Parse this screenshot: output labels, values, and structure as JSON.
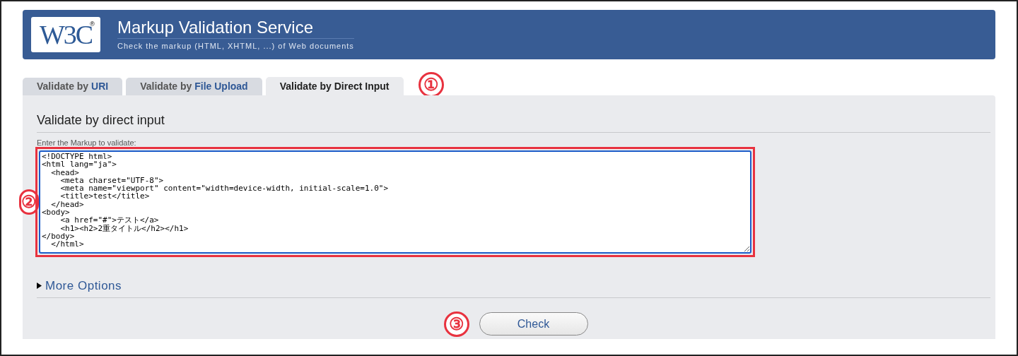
{
  "header": {
    "logo": "W3C",
    "logo_mark": "®",
    "title": "Markup Validation Service",
    "subtitle": "Check the markup (HTML, XHTML, ...) of Web documents"
  },
  "tabs": [
    {
      "prefix": "Validate by ",
      "label": "URI",
      "selected": false
    },
    {
      "prefix": "Validate by ",
      "label": "File Upload",
      "selected": false
    },
    {
      "prefix": "Validate by ",
      "label": "Direct Input",
      "selected": true
    }
  ],
  "annotations": [
    "①",
    "②",
    "③"
  ],
  "form": {
    "heading": "Validate by direct input",
    "field_label": "Enter the Markup to validate:",
    "value": "<!DOCTYPE html>\n<html lang=\"ja\">\n  <head>\n    <meta charset=\"UTF-8\">\n    <meta name=\"viewport\" content=\"width=device-width, initial-scale=1.0\">\n    <title>test</title>\n  </head>\n<body>\n    <a href=\"#\">テスト</a>\n    <h1><h2>2重タイトル</h2></h1>\n</body>\n  </html>",
    "more_options": {
      "label": "More Options",
      "expanded": false
    },
    "submit": "Check"
  }
}
